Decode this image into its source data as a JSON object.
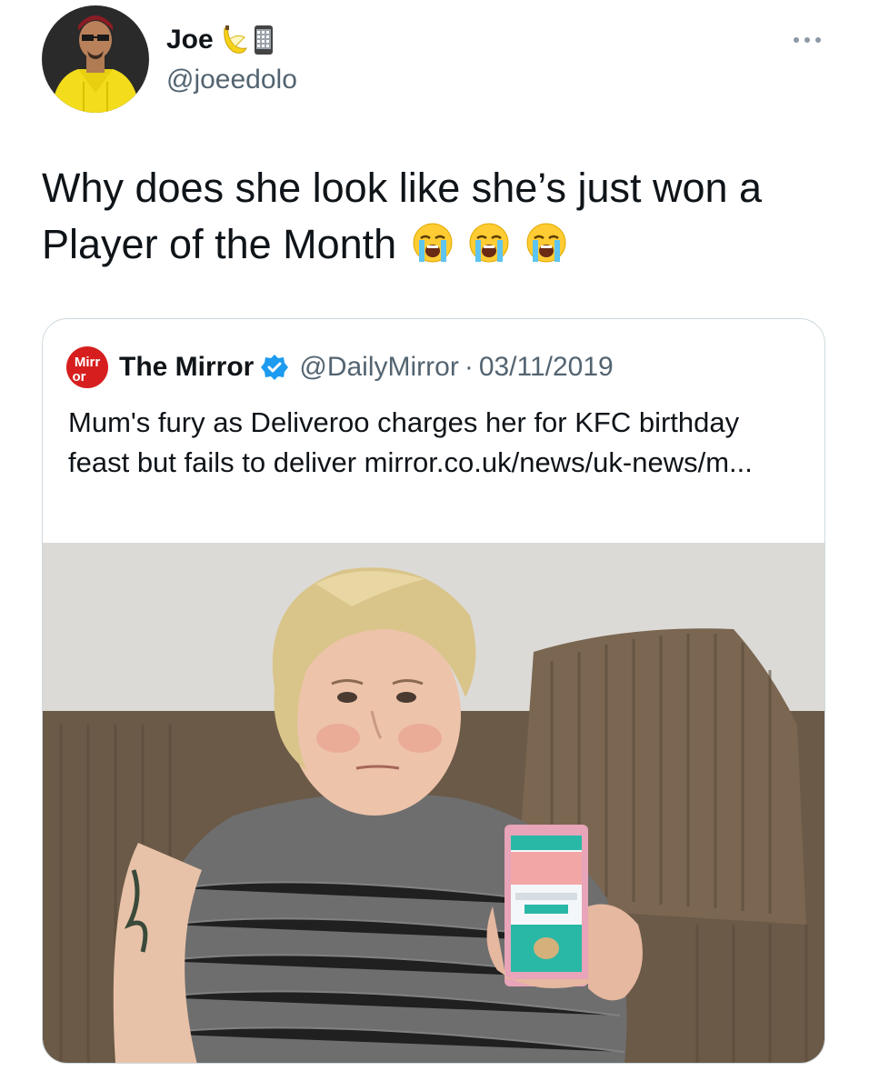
{
  "tweet": {
    "author": {
      "display_name": "Joe",
      "name_emojis": [
        "banana-emoji",
        "mobile-phone-emoji"
      ],
      "handle": "@joeedolo",
      "avatar": "profile-photo"
    },
    "text": "Why does she look like she’s just won a Player of the Month",
    "text_emojis": [
      "loudly-crying-face",
      "loudly-crying-face",
      "loudly-crying-face"
    ]
  },
  "quoted_tweet": {
    "logo_text": "Mirror",
    "name": "The Mirror",
    "verified": true,
    "handle": "@DailyMirror",
    "separator": "·",
    "date": "03/11/2019",
    "text": "Mum's fury as Deliveroo charges her for KFC birthday feast but fails to deliver mirror.co.uk/news/uk-news/m...",
    "image": "photo-woman-holding-phone-on-sofa"
  },
  "colors": {
    "text_primary": "#0f1419",
    "text_secondary": "#536471",
    "border": "#cfd9de",
    "verified_blue": "#1d9bf0",
    "mirror_red": "#d71e1e"
  }
}
